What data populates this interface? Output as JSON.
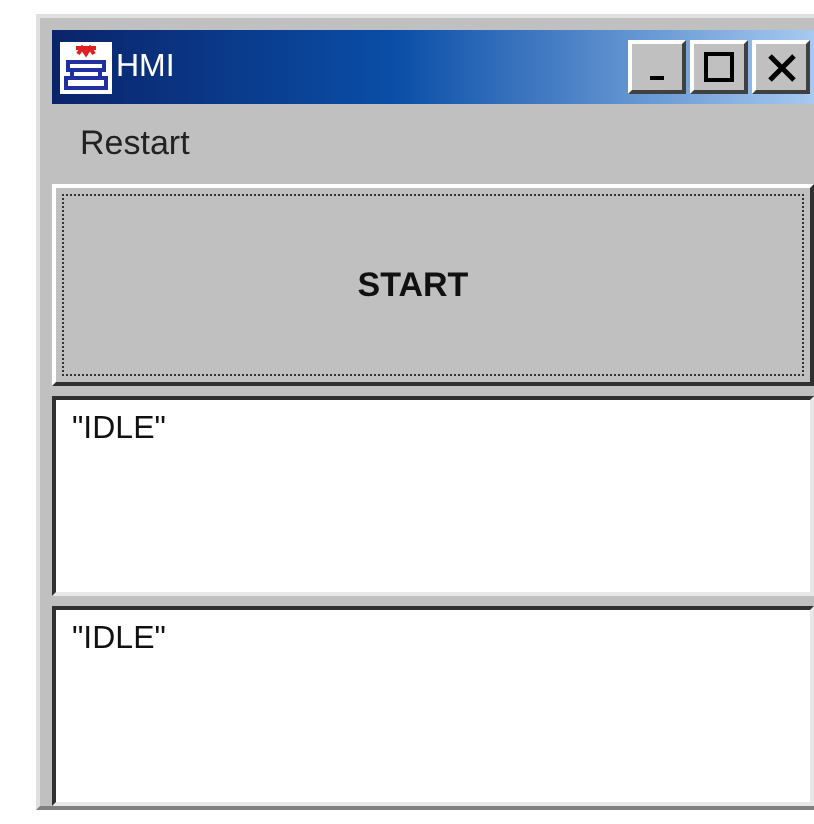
{
  "window": {
    "title": "HMI"
  },
  "menu": [
    {
      "label": "Restart"
    }
  ],
  "start_button": {
    "label": "START",
    "focused": true
  },
  "text_areas": [
    {
      "value": "\"IDLE\""
    },
    {
      "value": "\"IDLE\""
    }
  ]
}
